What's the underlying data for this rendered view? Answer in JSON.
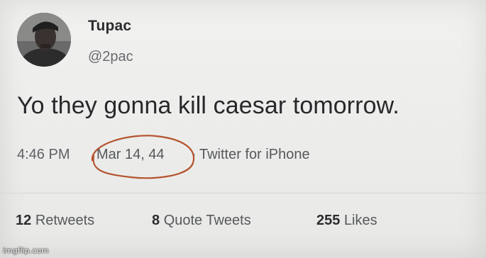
{
  "profile": {
    "display_name": "Tupac",
    "handle": "@2pac",
    "avatar_icon": "user-avatar-photo"
  },
  "tweet": {
    "text": "Yo they gonna kill caesar tomorrow.",
    "time": "4:46 PM",
    "date": "Mar 14, 44",
    "separator": "·",
    "source": "Twitter for iPhone"
  },
  "annotation": {
    "circle_color": "#b4532d"
  },
  "stats": {
    "retweets_count": "12",
    "retweets_label": "Retweets",
    "quotes_count": "8",
    "quotes_label": "Quote Tweets",
    "likes_count": "255",
    "likes_label": "Likes"
  },
  "watermark": {
    "text": "imgflip.com"
  }
}
